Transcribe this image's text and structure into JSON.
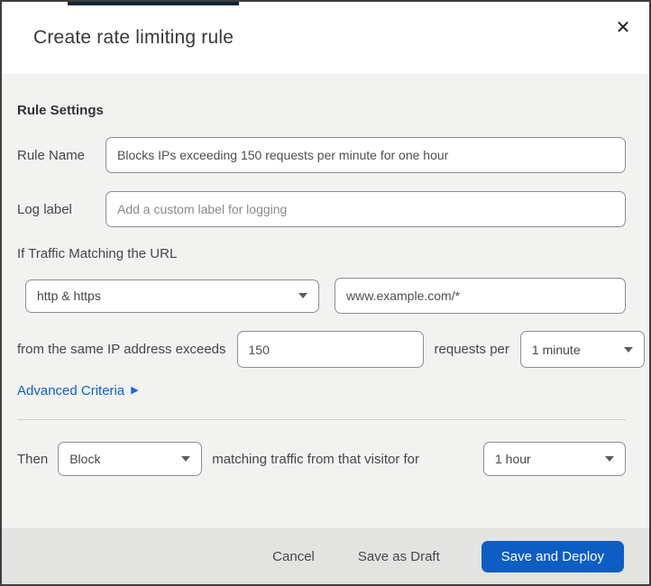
{
  "dialog": {
    "title": "Create rate limiting rule",
    "close_icon": "✕"
  },
  "rule_settings": {
    "heading": "Rule Settings",
    "rule_name": {
      "label": "Rule Name",
      "value": "Blocks IPs exceeding 150 requests per minute for one hour"
    },
    "log_label": {
      "label": "Log label",
      "placeholder": "Add a custom label for logging"
    }
  },
  "match": {
    "intro": "If Traffic Matching the URL",
    "scheme_select": {
      "value": "http & https"
    },
    "url_input": {
      "value": "www.example.com/*"
    },
    "threshold": {
      "prefix": "from the same IP address exceeds",
      "count_value": "150",
      "middle": "requests per",
      "period_select": {
        "value": "1 minute"
      }
    },
    "advanced_link": {
      "label": "Advanced Criteria",
      "icon": "▶"
    }
  },
  "action": {
    "prefix": "Then",
    "action_select": {
      "value": "Block"
    },
    "middle": "matching traffic from that visitor for",
    "duration_select": {
      "value": "1 hour"
    }
  },
  "footer": {
    "cancel": "Cancel",
    "save_draft": "Save as Draft",
    "save_deploy": "Save and Deploy"
  },
  "colors": {
    "accent_blue": "#0d5dc5",
    "link_blue": "#1160c4",
    "body_bg": "#f2f2f0",
    "footer_bg": "#e3e3e1",
    "top_bar_navy": "#0b2438",
    "input_border": "#8e8e8e"
  }
}
